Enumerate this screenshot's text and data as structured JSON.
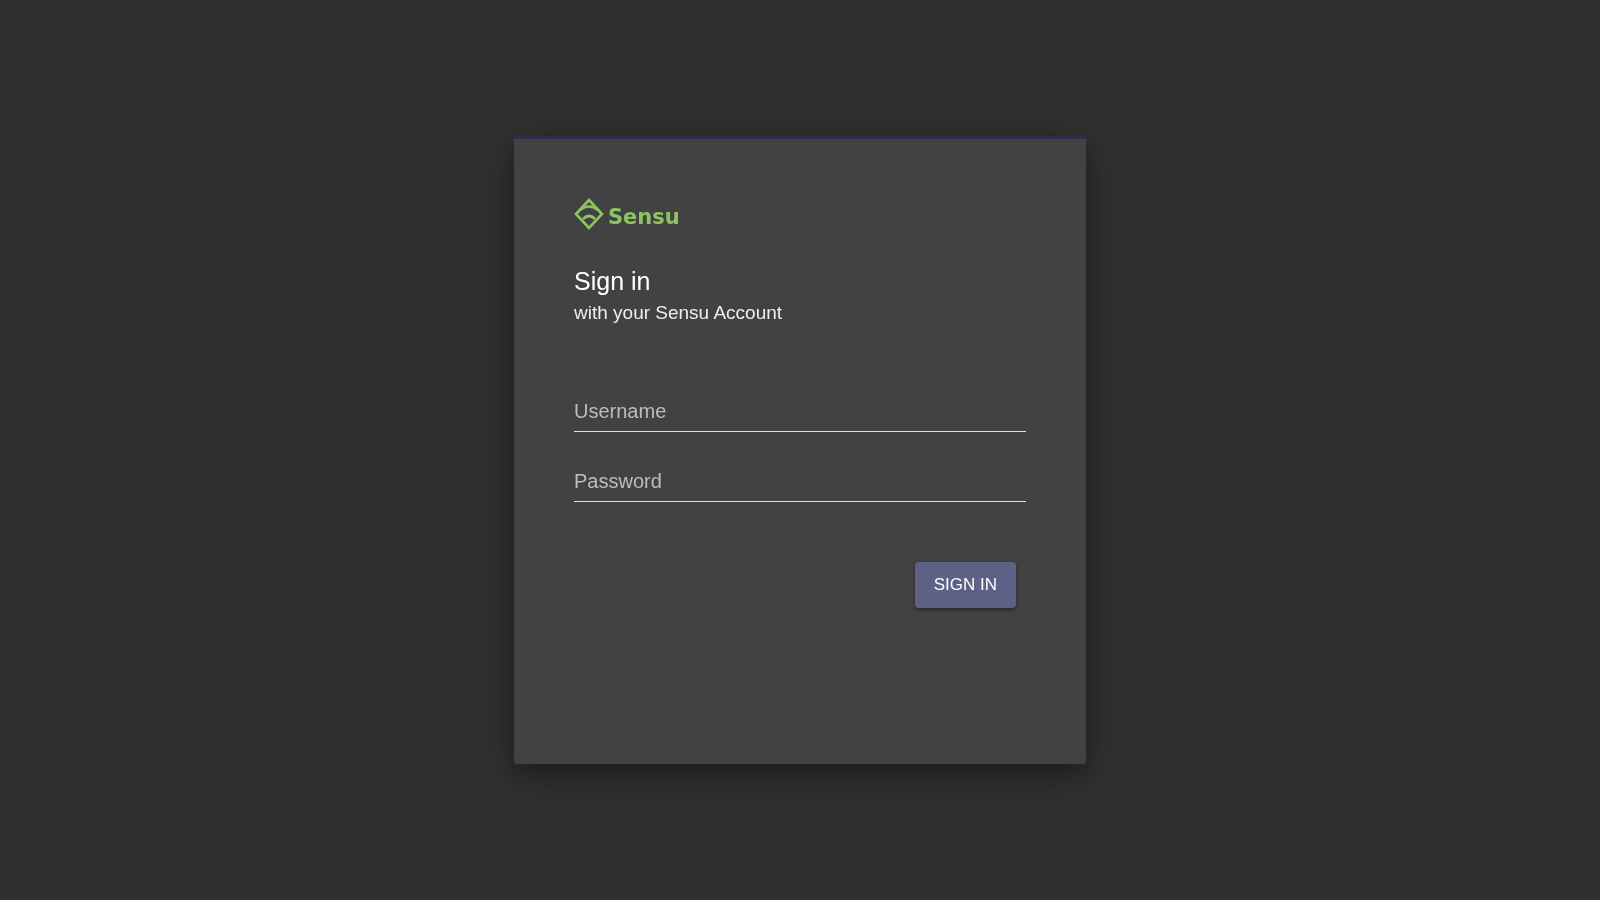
{
  "logo": {
    "text": "Sensu"
  },
  "heading": {
    "title": "Sign in",
    "subtitle": "with your Sensu Account"
  },
  "fields": [
    {
      "placeholder": "Username"
    },
    {
      "placeholder": "Password"
    }
  ],
  "buttons": [
    "SIGN IN"
  ]
}
